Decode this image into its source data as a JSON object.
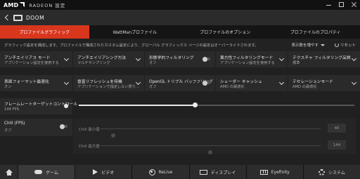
{
  "titlebar": {
    "brand": "AMD",
    "title": "RADEON 設定"
  },
  "header": {
    "game_title": "DOOM"
  },
  "tabs": [
    {
      "label": "プロファイルグラフィック",
      "active": true
    },
    {
      "label": "WattManプロファイル",
      "active": false
    },
    {
      "label": "プロファイルのオプション",
      "active": false
    },
    {
      "label": "プロファイルのプロパティ",
      "active": false
    }
  ],
  "infobar": {
    "text": "グラフィック設定を構成します。プロファイルで構成されたカスタム設定により、グローバル グラフィックス ページの設定はオーバーライドされます。",
    "more_label": "表示数を増やす",
    "reset_label": "リセット"
  },
  "settings": [
    {
      "title": "アンチエイリアス モード",
      "value": "アプリケーション設定を使用する",
      "control": "chevron"
    },
    {
      "title": "アンチエイリアシング方法",
      "value": "マルチサンプリング",
      "control": "chevron"
    },
    {
      "title": "形態学的フィルタリング",
      "value": "オフ",
      "control": "toggle"
    },
    {
      "title": "異方性フィルタリングモード",
      "value": "アプリケーション設定を使用する",
      "control": "chevron"
    },
    {
      "title": "テクスチャ フィルタリング品質",
      "value": "標準",
      "control": "chevron"
    },
    {
      "title": "表面フォーマット最適化",
      "value": "オン",
      "control": "chevron"
    },
    {
      "title": "垂直リフレッシュを待機",
      "value": "アプリケーションで指定しない限り…",
      "control": "chevron"
    },
    {
      "title": "OpenGL トリプル バッファリング",
      "value": "オフ",
      "control": "toggle"
    },
    {
      "title": "シェーダー キャッシュ",
      "value": "AMD の最適化",
      "control": "chevron"
    },
    {
      "title": "テセレーションモード",
      "value": "AMD の最適化",
      "control": "chevron"
    }
  ],
  "frame_rate": {
    "title": "フレームレートターゲットコントロール",
    "value": "144 FPS",
    "slider_fraction": 0.42
  },
  "chill": {
    "title": "Chill (FPS)",
    "value": "オフ",
    "min_label": "Chill 最小値",
    "min_value": "40",
    "min_fraction": 0.06,
    "max_label": "Chill 最大値",
    "max_value": "144",
    "max_fraction": 0.5
  },
  "bottom_nav": [
    {
      "label": "ゲーム",
      "icon": "gamepad-icon",
      "active": true
    },
    {
      "label": "ビデオ",
      "icon": "play-icon",
      "active": false
    },
    {
      "label": "ReLive",
      "icon": "relive-icon",
      "active": false
    },
    {
      "label": "ディスプレイ",
      "icon": "display-icon",
      "active": false
    },
    {
      "label": "Eyefinity",
      "icon": "eyefinity-icon",
      "active": false
    },
    {
      "label": "システム",
      "icon": "system-icon",
      "active": false
    }
  ],
  "colors": {
    "accent": "#d9361e",
    "background": "#202020",
    "panel": "#2a2a2a"
  }
}
